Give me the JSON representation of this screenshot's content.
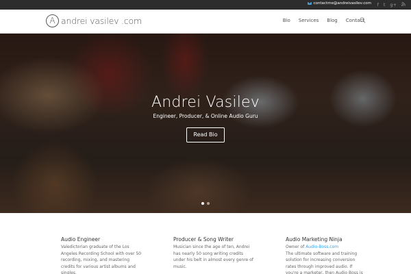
{
  "topbar": {
    "email": "contactme@andreivasilev.com",
    "social": [
      "f",
      "t",
      "g+",
      "rss"
    ]
  },
  "header": {
    "logo_mark": "A",
    "logo_text": "andrei vasilev .com",
    "nav": [
      "Bio",
      "Services",
      "Blog",
      "Contact"
    ]
  },
  "hero": {
    "title": "Andrei Vasilev",
    "subtitle": "Engineer, Producer, & Online Audio Guru",
    "button": "Read Bio",
    "slides": 2,
    "active_slide": 1
  },
  "features": [
    {
      "title": "Audio Engineer",
      "text": "Valedictorian graduate of the Los Angeles Recording School with over 50 recording, mixing, and mastering credits for various artist albums and singles."
    },
    {
      "title": "Producer & Song Writer",
      "text": "Musician since the age of ten, Andrei has nearly 50 song writing credits under his belt in almost every genre of music."
    },
    {
      "title": "Audio Marketing Ninja",
      "owner_prefix": "Owner of",
      "owner_link": "Audio-Boss.com",
      "text": "The ultimate software and training solution for increasing conversion rates through improved audio.  If you're a marketer, then Audio Boss is for you."
    }
  ],
  "colors": {
    "topbar": "#2d2d2d",
    "accent": "#2ea3f2"
  }
}
